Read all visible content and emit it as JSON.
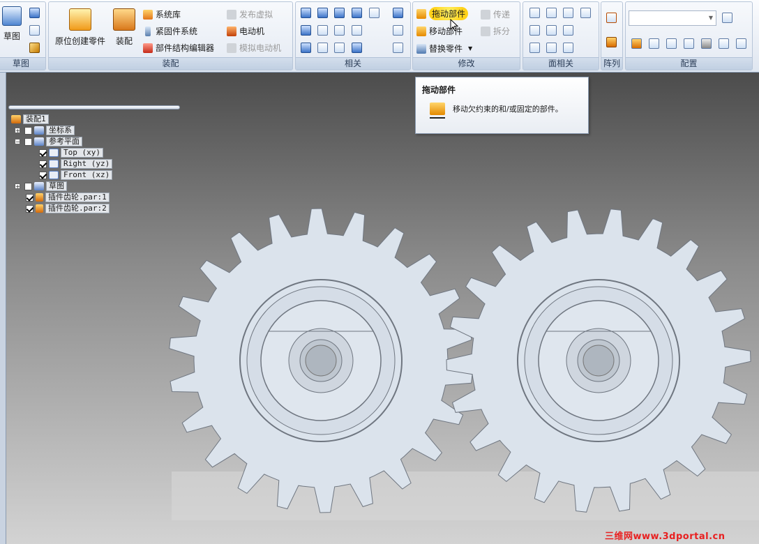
{
  "ribbon": {
    "sketch_group": {
      "button": "草图",
      "label": "草图"
    },
    "assembly_group": {
      "label": "装配",
      "create_in_place": "原位创建零件",
      "assemble": "装配",
      "system_library": "系统库",
      "fastener_system": "紧固件系统",
      "structure_editor": "部件结构编辑器",
      "publish_virtual": "发布虚拟",
      "motor": "电动机",
      "simulate_motor": "模拟电动机"
    },
    "relate_group": {
      "label": "相关"
    },
    "modify_group": {
      "label": "修改",
      "drag_component": "拖动部件",
      "move_component": "移动部件",
      "replace_part": "替换零件",
      "transfer": "传递",
      "disperse": "拆分"
    },
    "face_relate_group": {
      "label": "面相关"
    },
    "pattern_group": {
      "label": "阵列"
    },
    "config_group": {
      "label": "配置"
    }
  },
  "tooltip": {
    "title": "拖动部件",
    "description": "移动欠约束的和/或固定的部件。"
  },
  "tree": {
    "root": "装配1",
    "coord_system": "坐标系",
    "ref_planes": "参考平面",
    "plane_top": "Top (xy)",
    "plane_right": "Right (yz)",
    "plane_front": "Front (xz)",
    "sketch": "草图",
    "part1": "插件齿轮.par:1",
    "part2": "插件齿轮.par:2"
  },
  "watermark": "三维网www.3dportal.cn",
  "colors": {
    "gear_fill": "#dbe3ec",
    "gear_edge": "#6f7680",
    "highlight": "#ffd21a"
  }
}
